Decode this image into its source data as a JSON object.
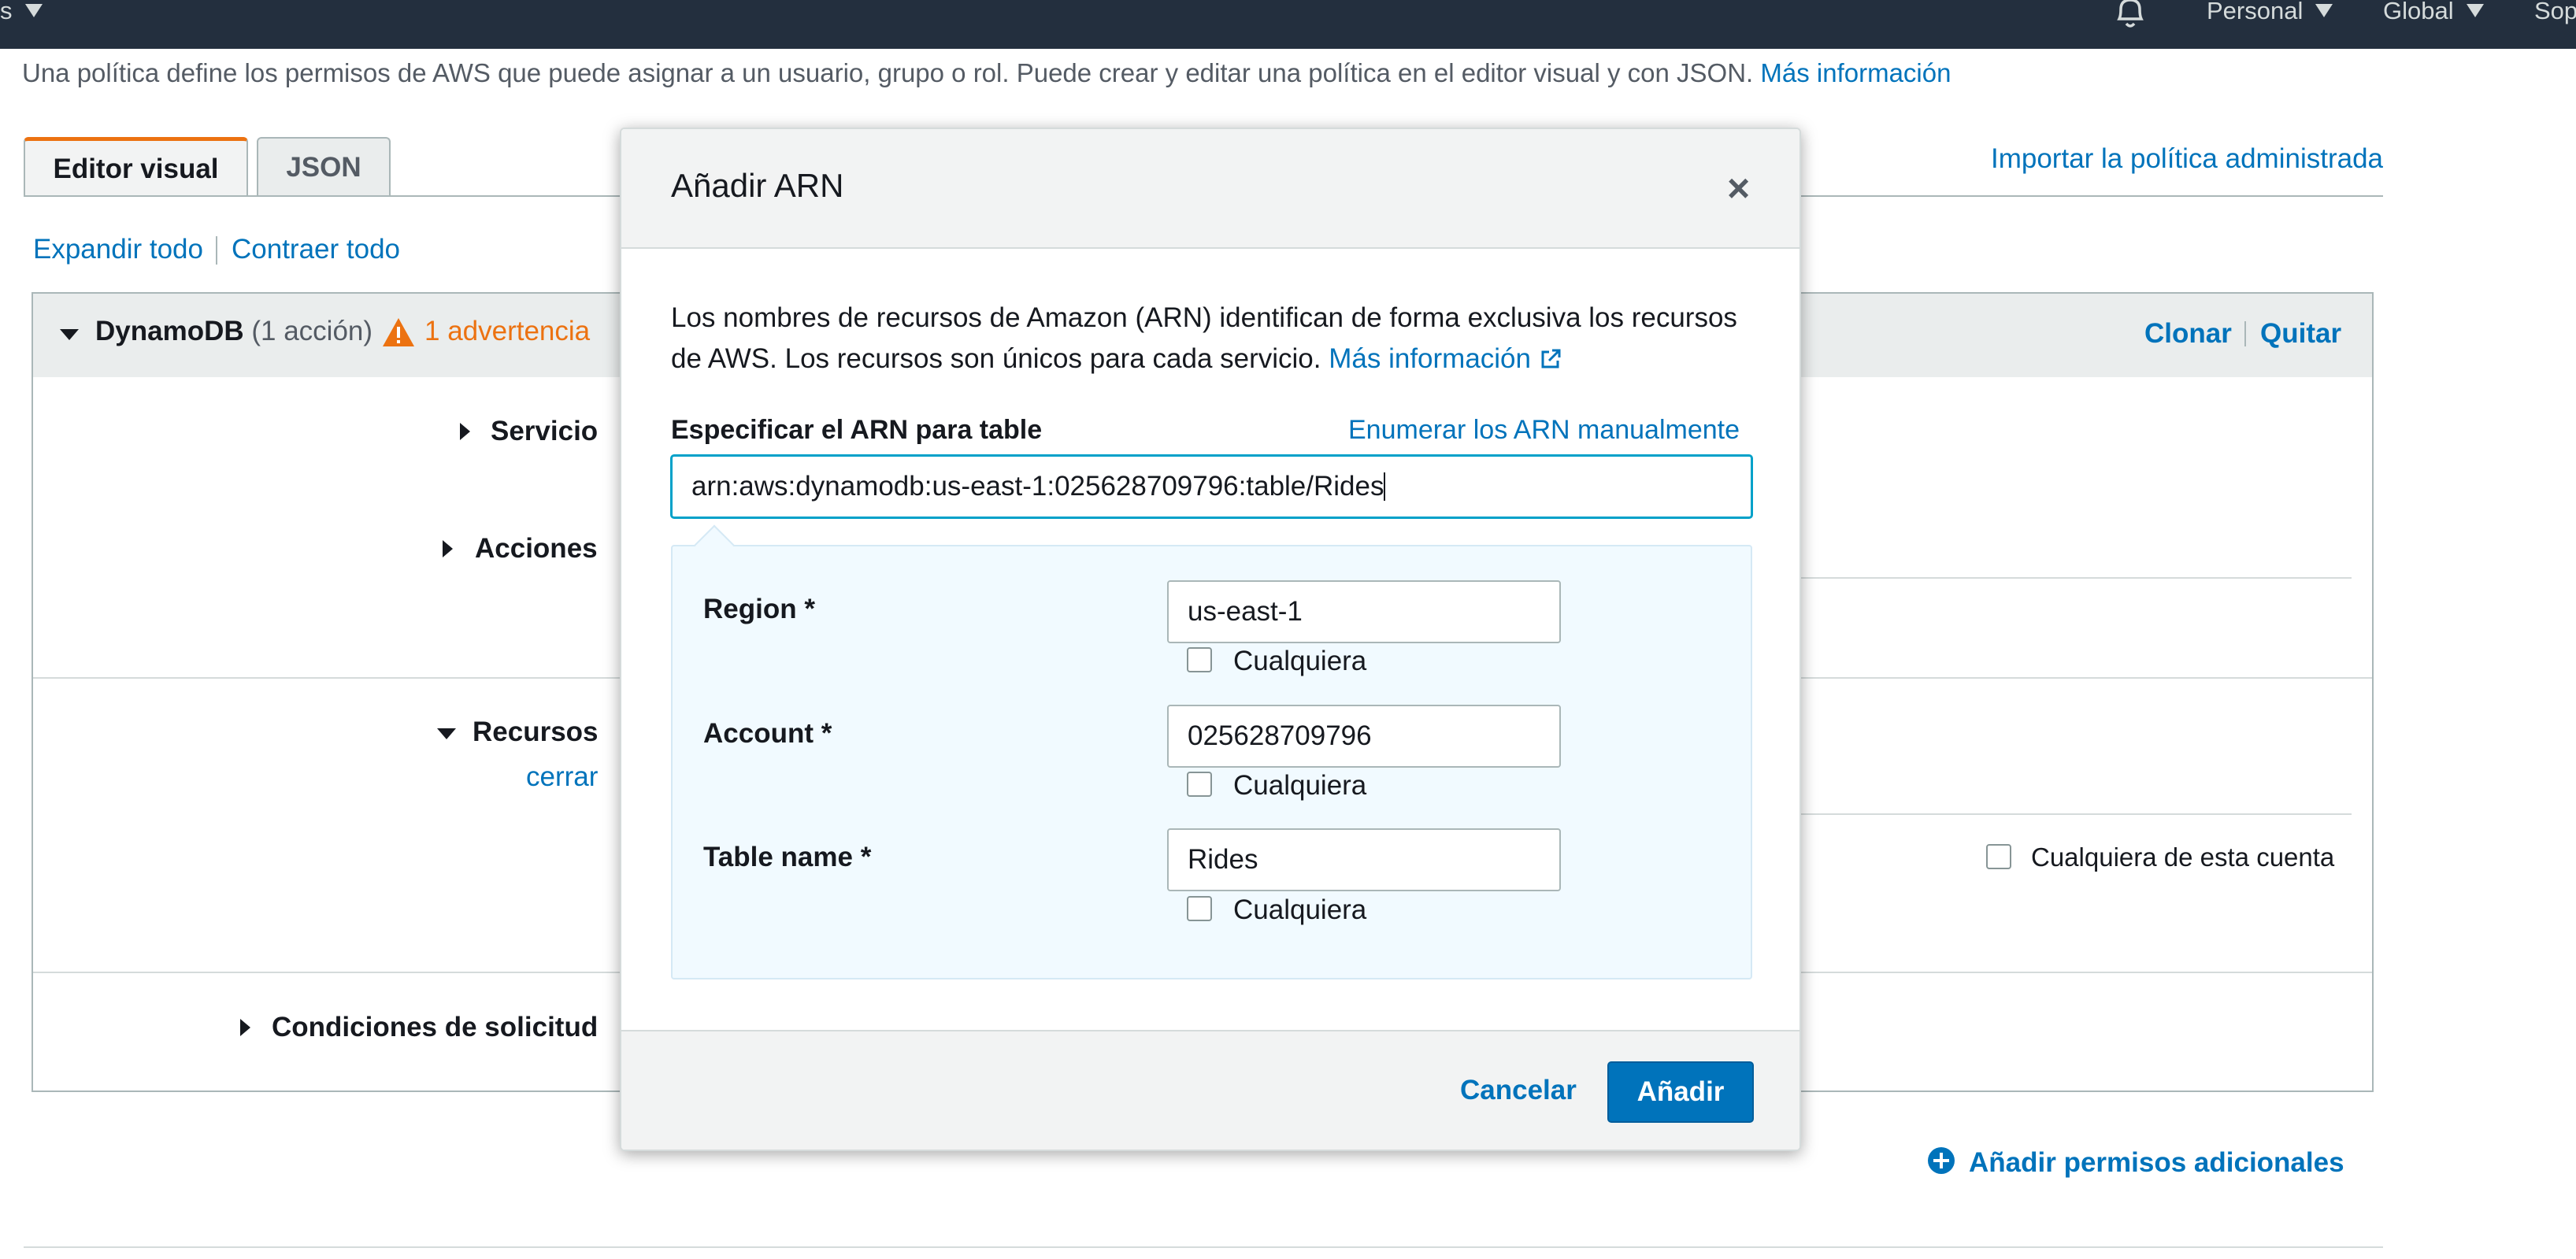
{
  "nav": {
    "left_text": "s",
    "account": "Personal",
    "region": "Global",
    "support": "Sop"
  },
  "intro": {
    "text": "Una política define los permisos de AWS que puede asignar a un usuario, grupo o rol. Puede crear y editar una política en el editor visual y con JSON.",
    "link": "Más información"
  },
  "tabs": {
    "visual": "Editor visual",
    "json": "JSON"
  },
  "import_link": "Importar la política administrada",
  "expand_all": "Expandir todo",
  "collapse_all": "Contraer todo",
  "section": {
    "service_name": "DynamoDB",
    "actions_count": "(1 acción)",
    "warning": "1 advertencia",
    "clone": "Clonar",
    "remove": "Quitar",
    "service_label": "Servicio",
    "actions_label": "Acciones",
    "resources_label": "Recursos",
    "close_link": "cerrar",
    "any_in_account": "Cualquiera de esta cuenta",
    "conditions_label": "Condiciones de solicitud"
  },
  "add_permissions": "Añadir permisos adicionales",
  "modal": {
    "title": "Añadir ARN",
    "close_symbol": "×",
    "description": "Los nombres de recursos de Amazon (ARN) identifican de forma exclusiva los recursos de AWS. Los recursos son únicos para cada servicio.",
    "more_info": "Más información",
    "specify_label": "Especificar el ARN para table",
    "list_manually": "Enumerar los ARN manualmente",
    "arn_value": "arn:aws:dynamodb:us-east-1:025628709796:table/Rides",
    "fields": [
      {
        "label": "Region *",
        "value": "us-east-1",
        "any": "Cualquiera"
      },
      {
        "label": "Account *",
        "value": "025628709796",
        "any": "Cualquiera"
      },
      {
        "label": "Table name *",
        "value": "Rides",
        "any": "Cualquiera"
      }
    ],
    "cancel": "Cancelar",
    "add": "Añadir"
  },
  "colors": {
    "nav_bg": "#232f3e",
    "link": "#0073bb",
    "warning": "#ec7211",
    "primary_button": "#0073bb"
  }
}
